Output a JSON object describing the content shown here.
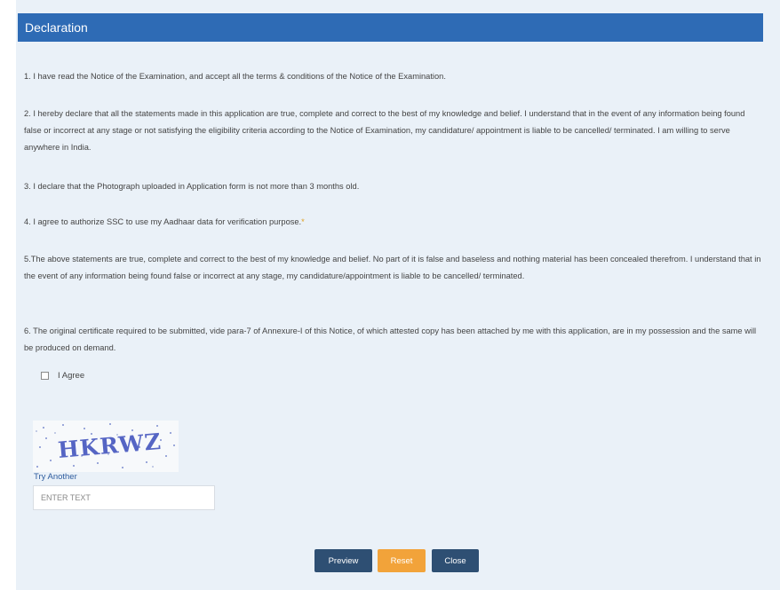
{
  "header": {
    "title": "Declaration"
  },
  "declarations": {
    "d1": "1. I have read the Notice of the Examination, and accept all the terms & conditions of the Notice of the Examination.",
    "d2": "2. I hereby declare that all the statements made in this application are true, complete and correct to the best of my knowledge and belief. I understand that in the event of any information being found false or incorrect at any stage or not satisfying the eligibility criteria according to the Notice of Examination, my candidature/ appointment is liable to be cancelled/ terminated. I am willing to serve anywhere in India.",
    "d3": "3. I declare that the Photograph uploaded in Application form is not more than 3 months old.",
    "d4": "4. I agree to authorize SSC to use my Aadhaar data for verification purpose.",
    "d4_marker": "*",
    "d5": "5.The above statements are true, complete and correct to the best of my knowledge and belief. No part of it is false and baseless and nothing material has been concealed therefrom. I understand that in the event of any information being found false or incorrect at any stage, my candidature/appointment is liable to be cancelled/ terminated.",
    "d6": "6. The original certificate required to be submitted, vide para-7 of Annexure-I of this Notice, of which attested copy has been attached by me with this application, are in my possession and the same will be produced on demand."
  },
  "agree": {
    "label": "I Agree",
    "checked": false
  },
  "captcha": {
    "text": "HKRWZ",
    "try_another": "Try Another",
    "input_placeholder": "ENTER TEXT",
    "input_value": ""
  },
  "buttons": {
    "preview": "Preview",
    "reset": "Reset",
    "close": "Close"
  },
  "colors": {
    "header_bg": "#2e6bb5",
    "panel_bg": "#eaf1f8",
    "button_dark": "#2e4f73",
    "button_reset": "#f2a33a",
    "required_marker": "#e0a020",
    "captcha_text": "#5565c4"
  }
}
